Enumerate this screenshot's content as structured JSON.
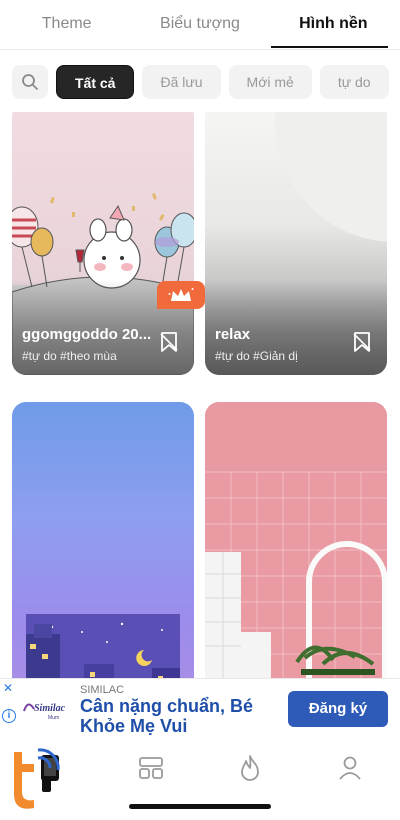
{
  "tabs": [
    {
      "label": "Theme",
      "active": false
    },
    {
      "label": "Biểu tượng",
      "active": false
    },
    {
      "label": "Hình nền",
      "active": true
    }
  ],
  "filters": {
    "search_icon": "search-icon",
    "chips": [
      {
        "label": "Tất cả",
        "active": true
      },
      {
        "label": "Đã lưu",
        "active": false
      },
      {
        "label": "Mới mẻ",
        "active": false
      },
      {
        "label": "tự do",
        "active": false
      }
    ]
  },
  "wallpapers": [
    {
      "title": "ggomggoddo 20...",
      "tags": "#tự do #theo mùa",
      "saved": false
    },
    {
      "title": "relax",
      "tags": "#tự do #Giản dị",
      "saved": false
    },
    {
      "title": "",
      "tags": "",
      "premium": true
    },
    {
      "title": "",
      "tags": ""
    }
  ],
  "ad": {
    "brand": "SIMILAC",
    "headline": "Cân nặng chuẩn, Bé Khỏe Mẹ Vui",
    "cta": "Đăng ký",
    "logo_text": "Similac",
    "logo_sub": "Mum",
    "info_icon": "i",
    "close_icon": "✕"
  },
  "bottom_nav": [
    {
      "icon": "phone-icon",
      "active": true
    },
    {
      "icon": "widgets-icon",
      "active": false
    },
    {
      "icon": "fire-icon",
      "active": false
    },
    {
      "icon": "profile-icon",
      "active": false
    }
  ],
  "colors": {
    "accent_orange": "#f06a3b",
    "ad_blue": "#2e5bb8",
    "watermark_orange": "#f28a2e"
  }
}
